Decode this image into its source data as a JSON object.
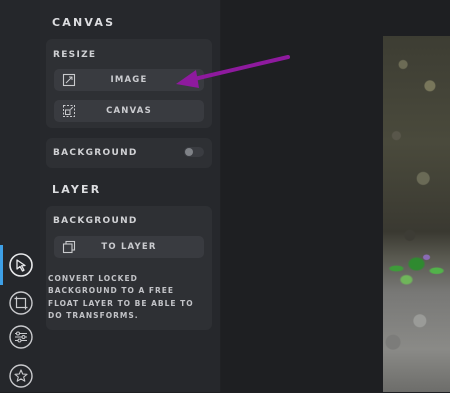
{
  "panel": {
    "canvas_title": "CANVAS",
    "resize": {
      "label": "RESIZE",
      "image_button": "IMAGE",
      "canvas_button": "CANVAS"
    },
    "background_toggle": {
      "label": "BACKGROUND",
      "checked": false
    },
    "layer_title": "LAYER",
    "layer_card": {
      "label": "BACKGROUND",
      "to_layer_button": "TO LAYER",
      "description": "CONVERT LOCKED BACKGROUND TO A FREE FLOAT LAYER TO BE ABLE TO DO TRANSFORMS."
    }
  },
  "tools": [
    {
      "icon": "cursor-select-icon",
      "active": true
    },
    {
      "icon": "crop-frame-icon",
      "active": false
    },
    {
      "icon": "adjust-sliders-icon",
      "active": false
    },
    {
      "icon": "star-badge-icon",
      "active": false
    }
  ],
  "colors": {
    "accent": "#3ea0e7",
    "annotation_arrow": "#8e1a9e"
  }
}
